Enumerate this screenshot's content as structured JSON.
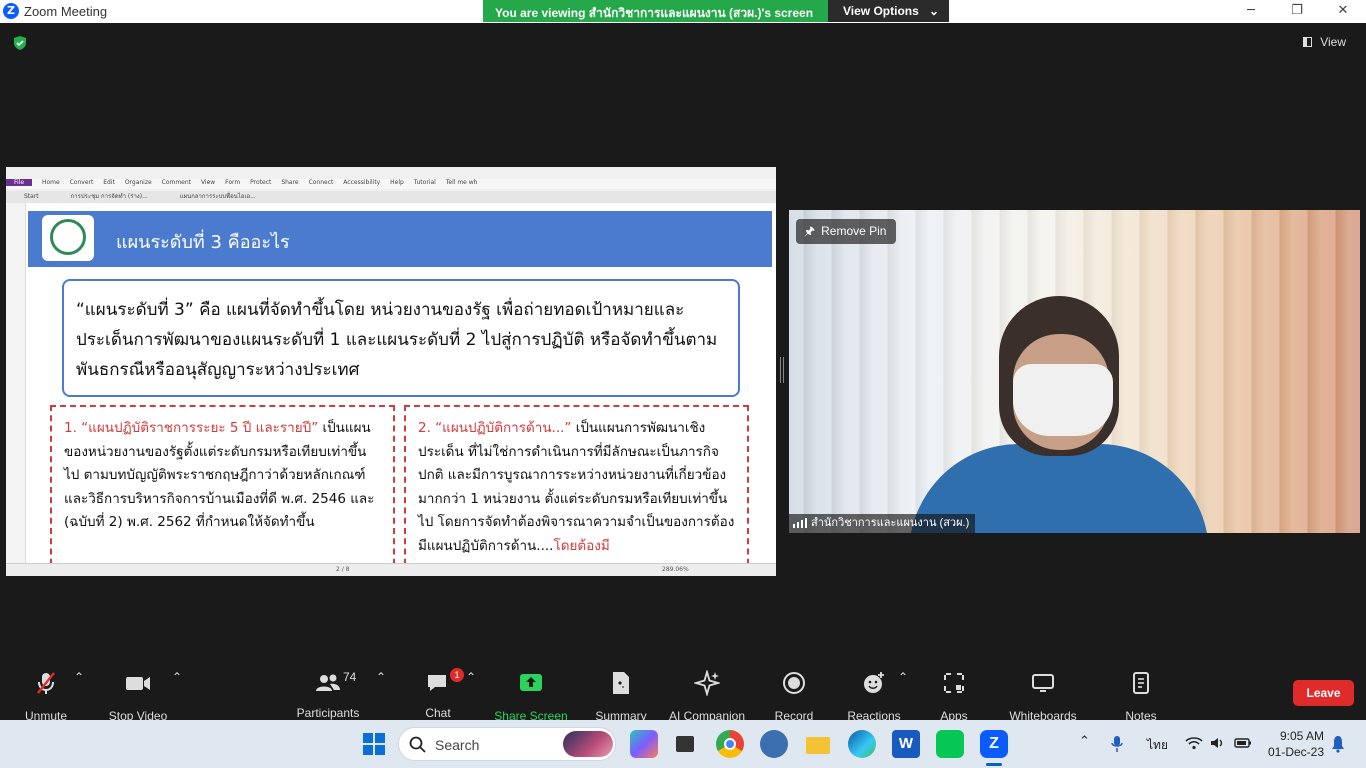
{
  "window": {
    "title": "Zoom Meeting",
    "minimize": "─",
    "restore": "❐",
    "close": "✕"
  },
  "share_banner": {
    "message": "You are viewing สำนักวิชาการและแผนงาน (สวผ.)'s screen",
    "view_options": "View Options",
    "chevron": "⌄"
  },
  "top_right": {
    "view_label": "View"
  },
  "shared_screen": {
    "pdf_menu": [
      "File",
      "Home",
      "Convert",
      "Edit",
      "Organize",
      "Comment",
      "View",
      "Form",
      "Protect",
      "Share",
      "Connect",
      "Accessibility",
      "Help",
      "Tutorial",
      "Tell me wh"
    ],
    "pdf_tabs": [
      "Start",
      "การประชุม การจัดทำ (ร่าง)...",
      "แผนกลาการระบบพื่อนไอเอ..."
    ],
    "page_indicator": "2 / 8",
    "zoom_level": "289.06%",
    "slide": {
      "heading": "แผนระดับที่ 3 คืออะไร",
      "definition": "“แผนระดับที่ 3” คือ แผนที่จัดทำขึ้นโดย หน่วยงานของรัฐ เพื่อถ่ายทอดเป้าหมายและประเด็นการพัฒนาของแผนระดับที่ 1 และแผนระดับที่ 2 ไปสู่การปฏิบัติ หรือจัดทำขึ้นตามพันธกรณีหรืออนุสัญญาระหว่างประเทศ",
      "col1_title": "1. “แผนปฏิบัติราชการระยะ 5 ปี และรายปี”",
      "col1_text": " เป็นแผนของหน่วยงานของรัฐตั้งแต่ระดับกรมหรือเทียบเท่าขึ้นไป ตามบทบัญญัติพระราชกฤษฎีกาว่าด้วยหลักเกณฑ์และวิธีการบริหารกิจการบ้านเมืองที่ดี พ.ศ. 2546 และ (ฉบับที่ 2) พ.ศ. 2562 ที่กำหนดให้จัดทำขึ้น",
      "col2_title": "2. “แผนปฏิบัติการด้าน...”",
      "col2_text": " เป็นแผนการพัฒนาเชิงประเด็น ที่ไม่ใช่การดำเนินการที่มีลักษณะเป็นภารกิจปกติ และมีการบูรณาการระหว่างหน่วยงานที่เกี่ยวข้องมากกว่า 1 หน่วยงาน ตั้งแต่ระดับกรมหรือเทียบเท่าขึ้นไป โดยการจัดทำต้องพิจารณาความจำเป็นของการต้องมีแผนปฏิบัติการด้าน....",
      "col2_tail": "โดยต้องมี"
    }
  },
  "video": {
    "remove_pin": "Remove Pin",
    "participant_name": "สำนักวิชาการและแผนงาน (สวผ.)"
  },
  "toolbar": {
    "unmute": "Unmute",
    "stop_video": "Stop Video",
    "participants": "Participants",
    "participants_count": "74",
    "chat": "Chat",
    "chat_badge": "1",
    "share_screen": "Share Screen",
    "summary": "Summary",
    "ai_companion": "AI Companion",
    "record": "Record",
    "reactions": "Reactions",
    "apps": "Apps",
    "whiteboards": "Whiteboards",
    "notes": "Notes",
    "leave": "Leave",
    "caret": "⌃"
  },
  "taskbar": {
    "search_placeholder": "Search",
    "language": "ไทย",
    "time": "9:05 AM",
    "date": "01-Dec-23"
  }
}
